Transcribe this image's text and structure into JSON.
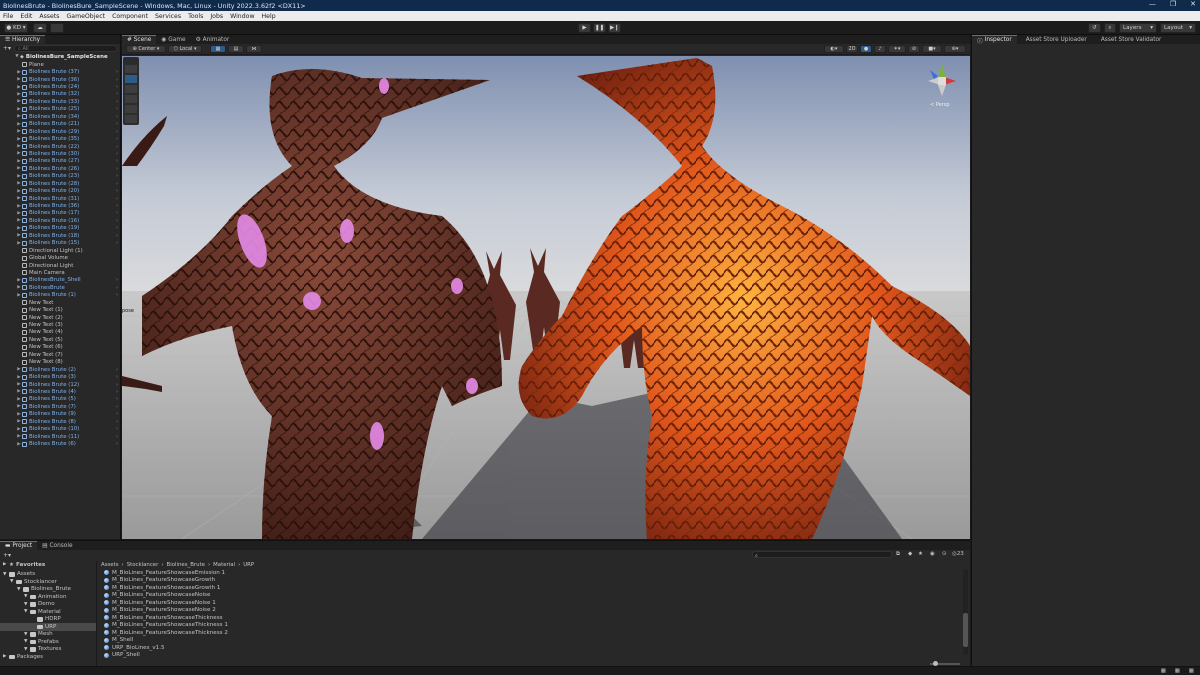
{
  "window": {
    "title": "BiolinesBrute - BiolinesBure_SampleScene - Windows, Mac, Linux - Unity 2022.3.62f2 <DX11>",
    "controls": [
      "—",
      "❐",
      "✕"
    ]
  },
  "menu": [
    "File",
    "Edit",
    "Assets",
    "GameObject",
    "Component",
    "Services",
    "Tools",
    "Jobs",
    "Window",
    "Help"
  ],
  "toolbar": {
    "account": "KD",
    "layers_label": "Layers",
    "layout_label": "Layout"
  },
  "hierarchy": {
    "tab": "Hierarchy",
    "search_placeholder": "All",
    "scene_name": "BiolinesBure_SampleScene",
    "items": [
      {
        "label": "Plane",
        "kind": "plain",
        "arrow": false
      },
      {
        "label": "Biolines Brute (37)",
        "kind": "prefab",
        "arrow": true
      },
      {
        "label": "Biolines Brute (36)",
        "kind": "prefab",
        "arrow": true
      },
      {
        "label": "Biolines Brute (24)",
        "kind": "prefab",
        "arrow": true
      },
      {
        "label": "Biolines Brute (32)",
        "kind": "prefab",
        "arrow": true
      },
      {
        "label": "Biolines Brute (33)",
        "kind": "prefab",
        "arrow": true
      },
      {
        "label": "Biolines Brute (25)",
        "kind": "prefab",
        "arrow": true
      },
      {
        "label": "Biolines Brute (34)",
        "kind": "prefab",
        "arrow": true
      },
      {
        "label": "Biolines Brute (21)",
        "kind": "prefab",
        "arrow": true
      },
      {
        "label": "Biolines Brute (29)",
        "kind": "prefab",
        "arrow": true
      },
      {
        "label": "Biolines Brute (35)",
        "kind": "prefab",
        "arrow": true
      },
      {
        "label": "Biolines Brute (22)",
        "kind": "prefab",
        "arrow": true
      },
      {
        "label": "Biolines Brute (30)",
        "kind": "prefab",
        "arrow": true
      },
      {
        "label": "Biolines Brute (27)",
        "kind": "prefab",
        "arrow": true
      },
      {
        "label": "Biolines Brute (26)",
        "kind": "prefab",
        "arrow": true
      },
      {
        "label": "Biolines Brute (23)",
        "kind": "prefab",
        "arrow": true
      },
      {
        "label": "Biolines Brute (28)",
        "kind": "prefab",
        "arrow": true
      },
      {
        "label": "Biolines Brute (20)",
        "kind": "prefab",
        "arrow": true
      },
      {
        "label": "Biolines Brute (31)",
        "kind": "prefab",
        "arrow": true
      },
      {
        "label": "Biolines Brute (36)",
        "kind": "prefab",
        "arrow": true
      },
      {
        "label": "Biolines Brute (17)",
        "kind": "prefab",
        "arrow": true
      },
      {
        "label": "Biolines Brute (16)",
        "kind": "prefab",
        "arrow": true
      },
      {
        "label": "Biolines Brute (19)",
        "kind": "prefab",
        "arrow": true
      },
      {
        "label": "Biolines Brute (18)",
        "kind": "prefab",
        "arrow": true
      },
      {
        "label": "Biolines Brute (15)",
        "kind": "prefab",
        "arrow": true
      },
      {
        "label": "Directional Light (1)",
        "kind": "plain",
        "arrow": false
      },
      {
        "label": "Global Volume",
        "kind": "plain",
        "arrow": false
      },
      {
        "label": "Directional Light",
        "kind": "plain",
        "arrow": false
      },
      {
        "label": "Main Camera",
        "kind": "plain",
        "arrow": false
      },
      {
        "label": "BiolinesBrute_Shell",
        "kind": "prefab",
        "arrow": true
      },
      {
        "label": "BiolinesBrute",
        "kind": "prefab",
        "arrow": true
      },
      {
        "label": "Biolines Brute (1)",
        "kind": "prefab",
        "arrow": true
      },
      {
        "label": "New Text",
        "kind": "plain",
        "arrow": false
      },
      {
        "label": "New Text (1)",
        "kind": "plain",
        "arrow": false
      },
      {
        "label": "New Text (2)",
        "kind": "plain",
        "arrow": false
      },
      {
        "label": "New Text (3)",
        "kind": "plain",
        "arrow": false
      },
      {
        "label": "New Text (4)",
        "kind": "plain",
        "arrow": false
      },
      {
        "label": "New Text (5)",
        "kind": "plain",
        "arrow": false
      },
      {
        "label": "New Text (6)",
        "kind": "plain",
        "arrow": false
      },
      {
        "label": "New Text (7)",
        "kind": "plain",
        "arrow": false
      },
      {
        "label": "New Text (8)",
        "kind": "plain",
        "arrow": false
      },
      {
        "label": "Biolines Brute (2)",
        "kind": "prefab",
        "arrow": true
      },
      {
        "label": "Biolines Brute (3)",
        "kind": "prefab",
        "arrow": true
      },
      {
        "label": "Biolines Brute (12)",
        "kind": "prefab",
        "arrow": true
      },
      {
        "label": "Biolines Brute (4)",
        "kind": "prefab",
        "arrow": true
      },
      {
        "label": "Biolines Brute (5)",
        "kind": "prefab",
        "arrow": true
      },
      {
        "label": "Biolines Brute (7)",
        "kind": "prefab",
        "arrow": true
      },
      {
        "label": "Biolines Brute (9)",
        "kind": "prefab",
        "arrow": true
      },
      {
        "label": "Biolines Brute (8)",
        "kind": "prefab",
        "arrow": true
      },
      {
        "label": "Biolines Brute (10)",
        "kind": "prefab",
        "arrow": true
      },
      {
        "label": "Biolines Brute (11)",
        "kind": "prefab",
        "arrow": true
      },
      {
        "label": "Biolines Brute (6)",
        "kind": "prefab",
        "arrow": true
      }
    ]
  },
  "scene": {
    "tabs": [
      "Scene",
      "Game",
      "Animator"
    ],
    "active_tab": 0,
    "pivot_label": "Center",
    "space_label": "Local",
    "mode_2d": "2D",
    "gizmo_label": "< Persp",
    "world_label": "pose"
  },
  "inspector": {
    "tabs": [
      "Inspector",
      "Asset Store Uploader",
      "Asset Store Validator"
    ]
  },
  "project": {
    "tabs": [
      "Project",
      "Console"
    ],
    "favorites_label": "Favorites",
    "breadcrumb": [
      "Assets",
      "Stocklancer",
      "Biolines_Brute",
      "Material",
      "URP"
    ],
    "count_badge": "23",
    "tree": [
      {
        "label": "Assets",
        "indent": 0,
        "selected": false
      },
      {
        "label": "Stocklancer",
        "indent": 1,
        "selected": false
      },
      {
        "label": "Biolines_Brute",
        "indent": 2,
        "selected": false
      },
      {
        "label": "Animation",
        "indent": 3,
        "selected": false
      },
      {
        "label": "Demo",
        "indent": 3,
        "selected": false
      },
      {
        "label": "Material",
        "indent": 3,
        "selected": false
      },
      {
        "label": "HDRP",
        "indent": 4,
        "selected": false
      },
      {
        "label": "URP",
        "indent": 4,
        "selected": true
      },
      {
        "label": "Mesh",
        "indent": 3,
        "selected": false
      },
      {
        "label": "Prefabs",
        "indent": 3,
        "selected": false
      },
      {
        "label": "Textures",
        "indent": 3,
        "selected": false
      },
      {
        "label": "Packages",
        "indent": 0,
        "selected": false
      }
    ],
    "files": [
      "M_BioLines_FeatureShowcaseEmission 1",
      "M_BioLines_FeatureShowcaseGrowth",
      "M_BioLines_FeatureShowcaseGrowth 1",
      "M_BioLines_FeatureShowcaseNoise",
      "M_BioLines_FeatureShowcaseNoise 1",
      "M_BioLines_FeatureShowcaseNoise 2",
      "M_BioLines_FeatureShowcaseThickness",
      "M_BioLines_FeatureShowcaseThickness 1",
      "M_BioLines_FeatureShowcaseThickness 2",
      "M_Shell",
      "URP_BioLines_v1.5",
      "URP_Shell"
    ],
    "slider_value": 0.1
  }
}
